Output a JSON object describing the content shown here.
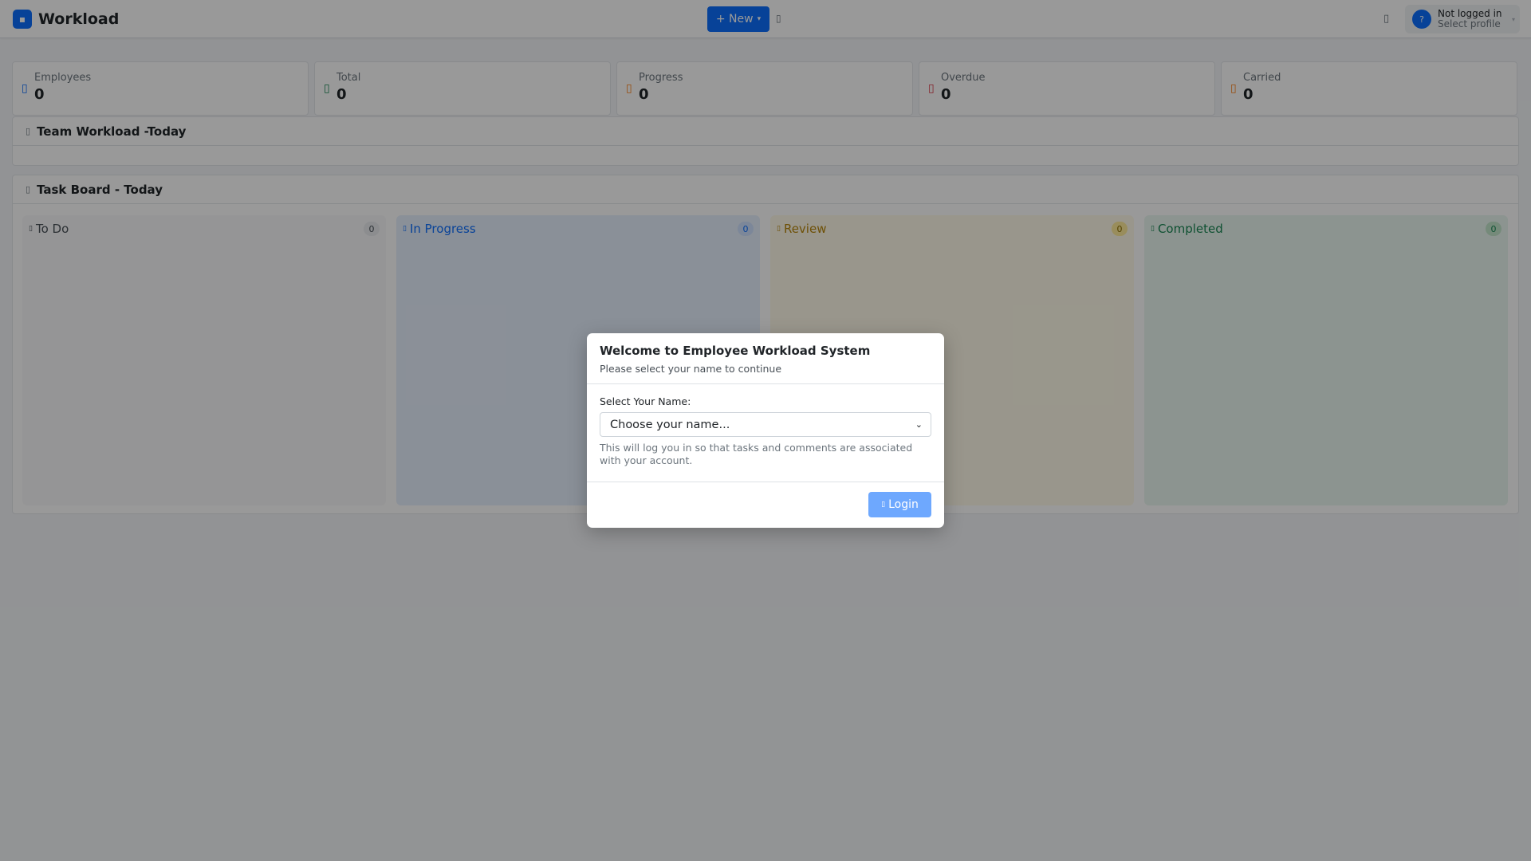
{
  "navbar": {
    "brand": "Workload",
    "brand_icon": "briefcase-icon",
    "new_button": "+ New",
    "user_avatar": "?",
    "user_status": "Not logged in",
    "user_sub": "Select profile"
  },
  "stats": [
    {
      "label": "Employees",
      "value": "0",
      "icon": "people-icon",
      "color": "#0d6efd"
    },
    {
      "label": "Total",
      "value": "0",
      "icon": "list-icon",
      "color": "#198754"
    },
    {
      "label": "Progress",
      "value": "0",
      "icon": "hourglass-icon",
      "color": "#fd7e14"
    },
    {
      "label": "Overdue",
      "value": "0",
      "icon": "warning-icon",
      "color": "#dc3545"
    },
    {
      "label": "Carried",
      "value": "0",
      "icon": "arrow-icon",
      "color": "#fd7e14"
    }
  ],
  "team_workload": {
    "title": "Team Workload -Today"
  },
  "task_board": {
    "title": "Task Board - Today",
    "columns": [
      {
        "label": "To Do",
        "count": "0",
        "color": "#495057",
        "bg": "#f8f9fa",
        "badge_bg": "#e9ecef"
      },
      {
        "label": "In Progress",
        "count": "0",
        "color": "#0d6efd",
        "bg": "#e7f0fd",
        "badge_bg": "#cfe2ff"
      },
      {
        "label": "Review",
        "count": "0",
        "color": "#b8860b",
        "bg": "#fffbea",
        "badge_bg": "#ffec99"
      },
      {
        "label": "Completed",
        "count": "0",
        "color": "#198754",
        "bg": "#eaf7f0",
        "badge_bg": "#c3e6cb"
      }
    ]
  },
  "modal": {
    "title": "Welcome to Employee Workload System",
    "subtitle": "Please select your name to continue",
    "field_label": "Select Your Name:",
    "select_value": "Choose your name...",
    "help": "This will log you in so that tasks and comments are associated with your account.",
    "login_button": "Login"
  }
}
